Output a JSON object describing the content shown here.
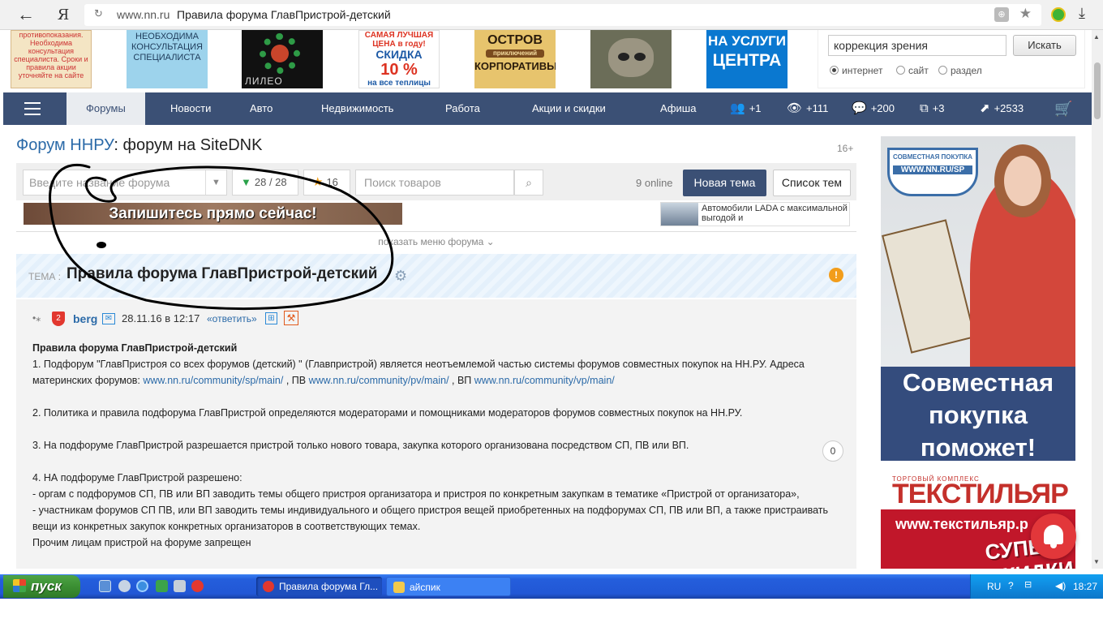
{
  "browser": {
    "back_glyph": "←",
    "ya_glyph": "Я",
    "domain": "www.nn.ru",
    "page_title": "Правила форума ГлавПристрой-детский"
  },
  "banners": {
    "b1_text": "противопоказания. Необходима консультация специалиста. Сроки и правила акции уточняйте на сайте",
    "b2_text": "НЕОБХОДИМА КОНСУЛЬТАЦИЯ СПЕЦИАЛИСТА",
    "b3_text": "ЛИЛЕО",
    "b4_top": "САМАЯ ЛУЧШАЯ ЦЕНА в году!",
    "b4_mid": "СКИДКА",
    "b4_big": "10 %",
    "b4_bot": "на все теплицы",
    "b5_top": "ОСТРОВ",
    "b5_mid": "приключений",
    "b5_bot": "КОРПОРАТИВЫ",
    "b7_top": "НА УСЛУГИ",
    "b7_bot": "ЦЕНТРА"
  },
  "top_search": {
    "value": "коррекция зрения",
    "button": "Искать",
    "options": [
      "интернет",
      "сайт",
      "раздел"
    ],
    "selected": "интернет"
  },
  "nav": {
    "items": [
      "Форумы",
      "Новости",
      "Авто",
      "Недвижимость",
      "Работа",
      "Акции и скидки",
      "Афиша"
    ],
    "stats": [
      "+1",
      "+111",
      "+200",
      "+3",
      "+2533"
    ]
  },
  "forum": {
    "title_link": "Форум ННРУ",
    "title_rest": ": форум на SiteDNK",
    "age": "16+",
    "select_placeholder": "Введите название форума",
    "filter_count": "28 / 28",
    "fav_count": "16",
    "goods_placeholder": "Поиск товаров",
    "online": "9 online",
    "new_topic": "Новая тема",
    "topics_list": "Список тем",
    "ad_banner": "Запишитесь прямо сейчас!",
    "ad_lada": "Автомобили LADA с максимальной выгодой и",
    "show_menu": "показать меню форума"
  },
  "topic": {
    "label": "ТЕМА :",
    "title": "Правила форума ГлавПристрой-детский"
  },
  "post": {
    "author": "berg",
    "badge": "2",
    "date": "28.11.16 в 12:17",
    "reply": "«ответить»",
    "counter": "0",
    "heading": "Правила форума ГлавПристрой-детский",
    "p1_a": "1. Подфорум \"ГлавПристроя со всех форумов (детский) \" (Главпристрой) является неотъемлемой частью системы форумов совместных покупок на НН.РУ. Адреса материнских форумов: ",
    "link1": "www.nn.ru/community/sp/main/",
    "p1_b": " , ПВ ",
    "link2": "www.nn.ru/community/pv/main/",
    "p1_c": " , ВП ",
    "link3": "www.nn.ru/community/vp/main/",
    "p2": "2. Политика и правила подфорума ГлавПристрой определяются модераторами и помощниками модераторов форумов совместных покупок на НН.РУ.",
    "p3": "3. На подфоруме ГлавПристрой разрешается пристрой только нового товара, закупка которого организована посредством СП, ПВ или ВП.",
    "p4": "4. НА подфоруме ГлавПристрой разрешено:",
    "p4_1": "- оргам с подфорумов СП, ПВ или ВП заводить темы общего пристроя организатора и пристроя по конкретным закупкам в тематике «Пристрой от организатора»,",
    "p4_2": "- участникам форумов СП ПВ, или ВП заводить темы индивидуального и общего пристроя вещей приобретенных на подфорумах СП, ПВ или ВП, а также пристраивать вещи из конкретных закупок конкретных организаторов в соответствующих темах.",
    "p4_3": "Прочим лицам пристрой на форуме запрещен"
  },
  "side_ads": {
    "sp_logo_top": "СОВМЕСТНАЯ ПОКУПКА",
    "sp_logo_url": "WWW.NN.RU/SP",
    "sp_caption": "Совместная покупка поможет!",
    "tk_top": "ТОРГОВЫЙ КОМПЛЕКС",
    "tk_brand": "ТЕКСТИЛЬЯР",
    "tk_site": "www.текстильяр.р",
    "tk_sale": "СУПЕР СКИДКИ"
  },
  "taskbar": {
    "start": "пуск",
    "tasks": [
      "Правила форума Гл...",
      "айспик"
    ],
    "lang": "RU",
    "help": "?",
    "clock": "18:27"
  }
}
